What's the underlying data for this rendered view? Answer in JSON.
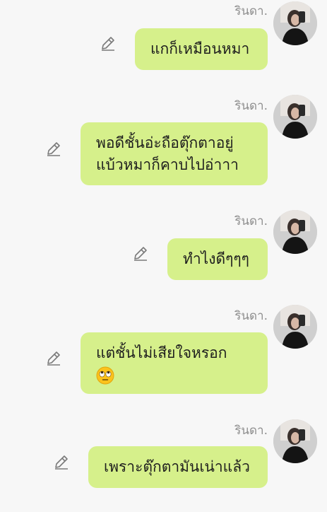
{
  "messages": [
    {
      "sender": "รินดา.",
      "lines": [
        "แกก็เหมือนหมา"
      ]
    },
    {
      "sender": "รินดา.",
      "lines": [
        "พอดีชั้นอ่ะถือตุ๊กตาอยู่",
        "แบ้วหมาก็คาบไปอ่าาา"
      ]
    },
    {
      "sender": "รินดา.",
      "lines": [
        "ทำไงดีๆๆๆ"
      ]
    },
    {
      "sender": "รินดา.",
      "lines": [
        "แต่ชั้นไม่เสียใจหรอก"
      ],
      "emoji": "face-with-rolling-eyes"
    },
    {
      "sender": "รินดา.",
      "lines": [
        "เพราะตุ๊กตามันเน่าแล้ว"
      ]
    }
  ],
  "icons": {
    "edit": "pencil-icon"
  },
  "colors": {
    "bubble": "#d6f08b",
    "background": "#f7f7f7",
    "sender_text": "#8e8e8e"
  }
}
